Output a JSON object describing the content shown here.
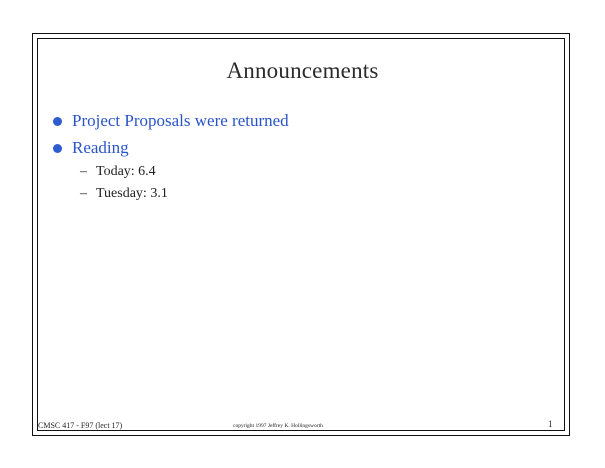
{
  "slide": {
    "title": "Announcements",
    "bullets": [
      {
        "text": "Project Proposals were returned"
      },
      {
        "text": "Reading"
      }
    ],
    "sub_bullets": [
      {
        "dash": "–",
        "text": "Today: 6.4"
      },
      {
        "dash": "–",
        "text": "Tuesday: 3.1"
      }
    ]
  },
  "footer": {
    "course": "CMSC 417 - F97  (lect 17)",
    "copyright": "copyright 1997 Jeffrey K. Hollingsworth",
    "page_number": "1"
  },
  "colors": {
    "bullet_text": "#2a55c9",
    "bullet_dot": "#2f5bd0",
    "body_text": "#222222"
  }
}
